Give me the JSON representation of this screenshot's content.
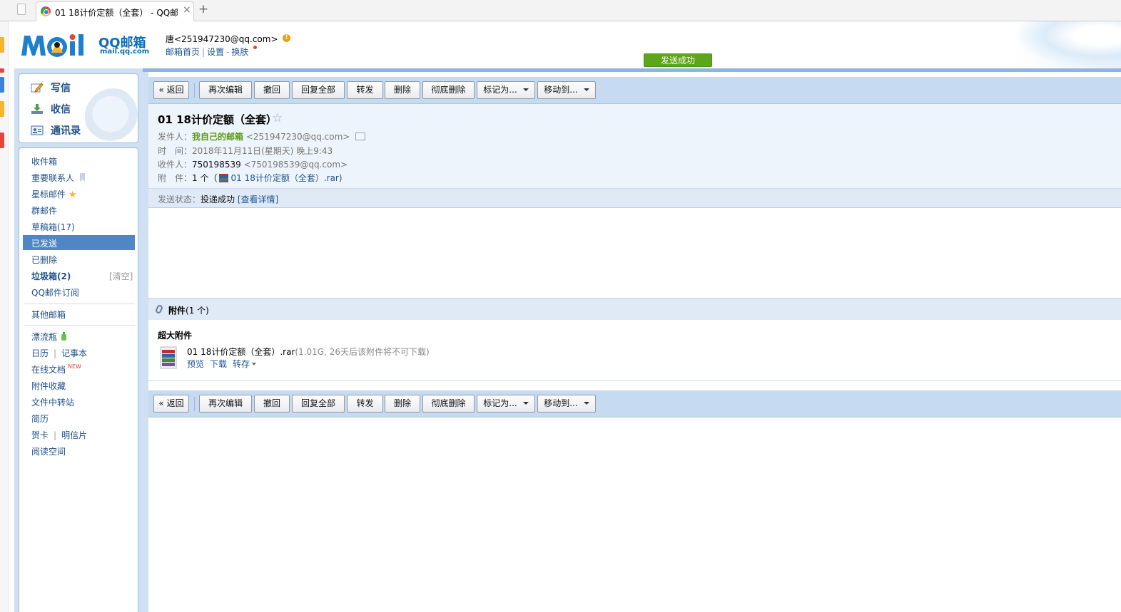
{
  "browser": {
    "tab_title": "01 18计价定额（全套） - QQ邮",
    "tab_close": "×",
    "new_tab": "+"
  },
  "header": {
    "logo_text": "QQ邮箱",
    "logo_sub": "mail.qq.com",
    "user_email": "唐<251947230@qq.com>",
    "warn": "!",
    "links": [
      "邮箱首页",
      "设置",
      "换肤"
    ],
    "send_success": "发送成功"
  },
  "quick": {
    "compose": "写信",
    "inbox": "收信",
    "contacts": "通讯录"
  },
  "folders": {
    "inbox": "收件箱",
    "vip": "重要联系人",
    "starred": "星标邮件",
    "group": "群邮件",
    "drafts": "草稿箱(17)",
    "sent": "已发送",
    "deleted": "已删除",
    "spam": "垃圾箱(2)",
    "spam_clear": "[清空]",
    "subscribe": "QQ邮件订阅",
    "other": "其他邮箱",
    "bottle": "漂流瓶",
    "calendar": "日历",
    "notes": "记事本",
    "docs": "在线文档",
    "docs_badge": "NEW",
    "att_fav": "附件收藏",
    "transfer": "文件中转站",
    "resume": "简历",
    "card": "贺卡",
    "postcard": "明信片",
    "reading": "阅读空间"
  },
  "toolbar": {
    "back": "« 返回",
    "reedit": "再次编辑",
    "recall": "撤回",
    "reply_all": "回复全部",
    "forward": "转发",
    "delete": "删除",
    "delete_perm": "彻底删除",
    "mark": "标记为...",
    "move": "移动到..."
  },
  "mail": {
    "subject": "01 18计价定额（全套）",
    "star": "☆",
    "from_label": "发件人：",
    "from_name": "我自己的邮箱",
    "from_addr": "<251947230@qq.com>",
    "time_label": "时　间：",
    "time": "2018年11月11日(星期天) 晚上9:43",
    "to_label": "收件人：",
    "to_name": "750198539",
    "to_addr": "<750198539@qq.com>",
    "att_label": "附　件：",
    "att_count": "1 个（",
    "att_file": "01 18计价定额（全套）.rar)",
    "status_label": "发送状态：",
    "status": "投递成功",
    "status_detail": "[查看详情]"
  },
  "attachments": {
    "title": "附件",
    "count": "(1 个)",
    "big_label": "超大附件",
    "file_name": "01 18计价定额（全套）.rar",
    "file_info": "(1.01G, 26天后该附件将不可下载)",
    "preview": "预览",
    "download": "下载",
    "save": "转存"
  },
  "colors": {
    "accent": "#1e5494",
    "frame": "#8cb5e0",
    "selected": "#4f86c6",
    "success": "#5da519"
  }
}
